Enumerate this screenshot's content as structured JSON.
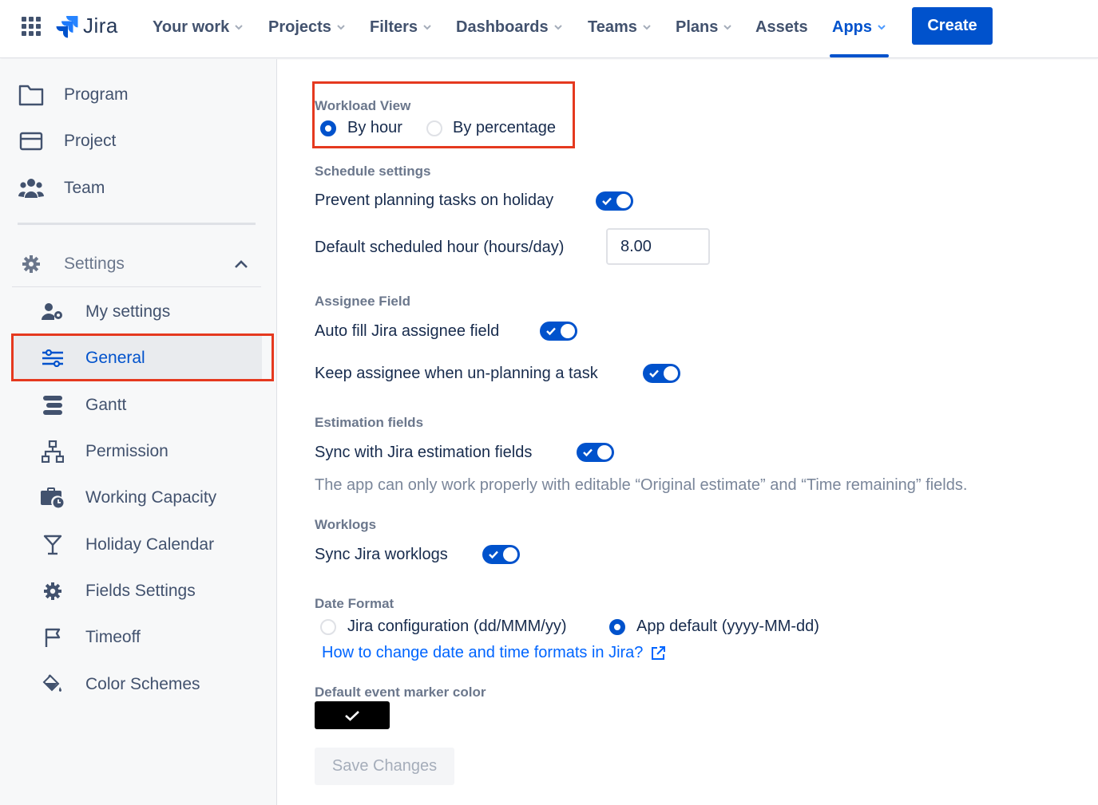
{
  "nav": {
    "logo": "Jira",
    "items": [
      {
        "label": "Your work",
        "dropdown": true
      },
      {
        "label": "Projects",
        "dropdown": true
      },
      {
        "label": "Filters",
        "dropdown": true
      },
      {
        "label": "Dashboards",
        "dropdown": true
      },
      {
        "label": "Teams",
        "dropdown": true
      },
      {
        "label": "Plans",
        "dropdown": true
      },
      {
        "label": "Assets",
        "dropdown": false
      },
      {
        "label": "Apps",
        "dropdown": true,
        "active": true
      }
    ],
    "create_label": "Create",
    "accent": "#0052cc"
  },
  "sidebar": {
    "top_items": [
      {
        "label": "Program",
        "icon": "folder-icon"
      },
      {
        "label": "Project",
        "icon": "card-icon"
      },
      {
        "label": "Team",
        "icon": "people-icon"
      }
    ],
    "settings_label": "Settings",
    "settings_expanded": true,
    "settings_items": [
      {
        "label": "My settings",
        "icon": "user-gear-icon"
      },
      {
        "label": "General",
        "icon": "sliders-icon",
        "selected": true
      },
      {
        "label": "Gantt",
        "icon": "gantt-icon"
      },
      {
        "label": "Permission",
        "icon": "hierarchy-icon"
      },
      {
        "label": "Working Capacity",
        "icon": "briefcase-clock-icon"
      },
      {
        "label": "Holiday Calendar",
        "icon": "cocktail-icon"
      },
      {
        "label": "Fields Settings",
        "icon": "gear-icon"
      },
      {
        "label": "Timeoff",
        "icon": "flag-icon"
      },
      {
        "label": "Color Schemes",
        "icon": "paint-bucket-icon"
      }
    ]
  },
  "main": {
    "workload": {
      "label": "Workload View",
      "options": [
        "By hour",
        "By percentage"
      ],
      "selected": "By hour"
    },
    "schedule": {
      "label": "Schedule settings",
      "prevent_holiday": {
        "text": "Prevent planning tasks on holiday",
        "on": true
      },
      "default_hour_label": "Default scheduled hour (hours/day)",
      "default_hour_value": "8.00"
    },
    "assignee": {
      "label": "Assignee Field",
      "auto_fill": {
        "text": "Auto fill Jira assignee field",
        "on": true
      },
      "keep": {
        "text": "Keep assignee when un-planning a task",
        "on": true
      }
    },
    "estimation": {
      "label": "Estimation fields",
      "sync": {
        "text": "Sync with Jira estimation fields",
        "on": true
      },
      "helper": "The app can only work properly with editable “Original estimate” and “Time remaining” fields."
    },
    "worklogs": {
      "label": "Worklogs",
      "sync": {
        "text": "Sync Jira worklogs",
        "on": true
      }
    },
    "date_format": {
      "label": "Date Format",
      "options": [
        "Jira configuration (dd/MMM/yy)",
        "App default (yyyy-MM-dd)"
      ],
      "selected": "App default (yyyy-MM-dd)",
      "help_link": "How to change date and time formats in Jira?"
    },
    "marker": {
      "label": "Default event marker color",
      "color": "#000000"
    },
    "save_label": "Save Changes"
  }
}
